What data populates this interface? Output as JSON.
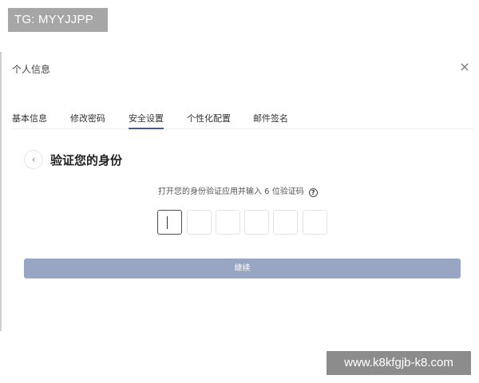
{
  "watermarks": {
    "top_left": "TG: MYYJJPP",
    "bottom_right": "www.k8kfgjb-k8.com"
  },
  "dialog": {
    "title": "个人信息",
    "close_icon": "×"
  },
  "tabs": [
    {
      "label": "基本信息",
      "active": false
    },
    {
      "label": "修改密码",
      "active": false
    },
    {
      "label": "安全设置",
      "active": true
    },
    {
      "label": "个性化配置",
      "active": false
    },
    {
      "label": "邮件签名",
      "active": false
    }
  ],
  "verify": {
    "back_icon": "‹",
    "title": "验证您的身份",
    "instruction": "打开您的身份验证应用并输入 6 位验证码",
    "help_icon": "?",
    "code_length": 6,
    "continue_label": "继续"
  },
  "colors": {
    "accent": "#3d4f78",
    "button_bg": "#98a6c3"
  }
}
